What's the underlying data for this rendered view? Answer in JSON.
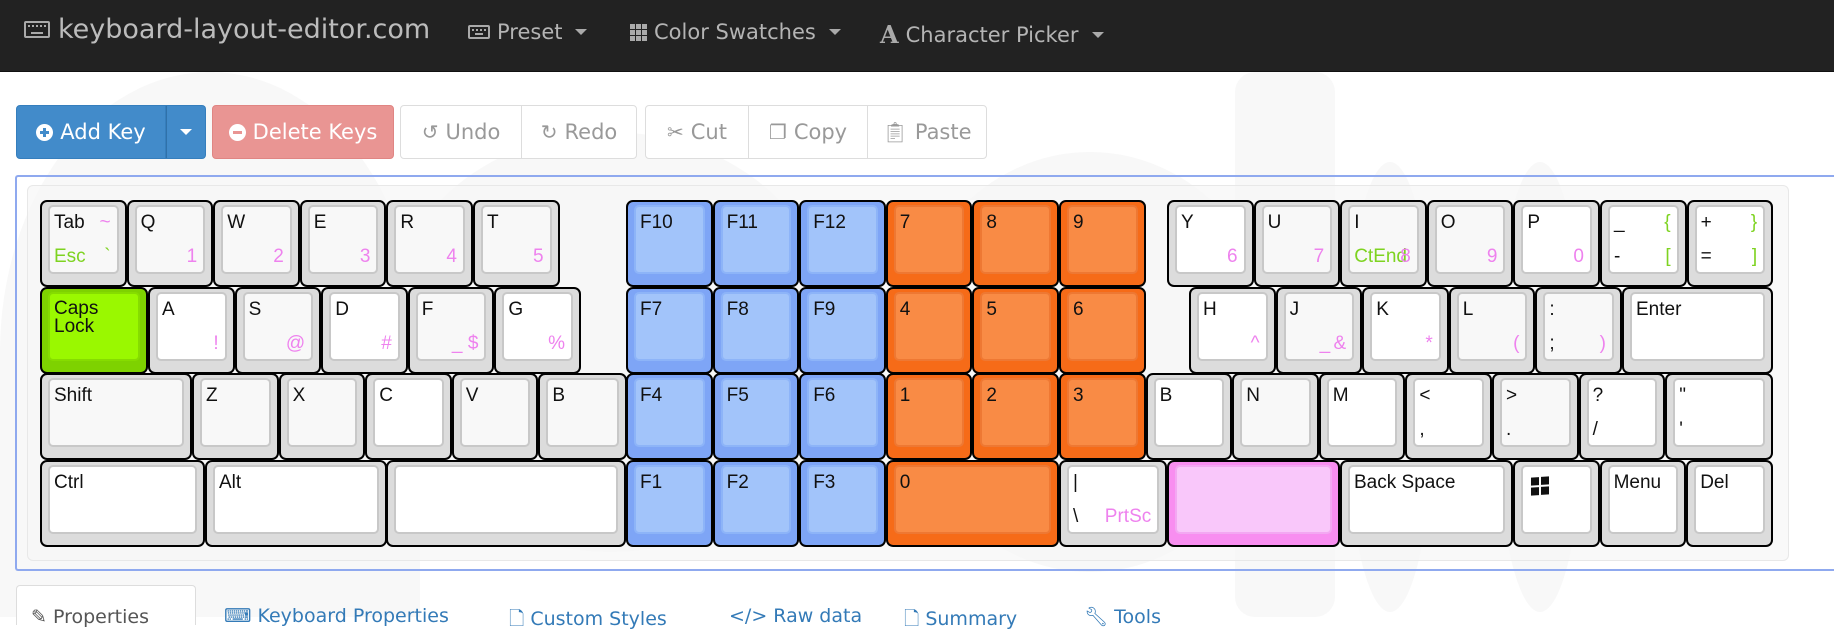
{
  "navbar": {
    "brand": "keyboard-layout-editor.com",
    "brand_icon": "keyboard-icon",
    "menus": [
      {
        "label": "Preset",
        "icon": "keyboard-icon"
      },
      {
        "label": "Color Swatches",
        "icon": "grid-icon"
      },
      {
        "label": "Character Picker",
        "icon": "font-icon"
      }
    ]
  },
  "toolbar": {
    "add_key": "Add Key",
    "delete_keys": "Delete Keys",
    "undo": "Undo",
    "redo": "Redo",
    "cut": "Cut",
    "copy": "Copy",
    "paste": "Paste"
  },
  "colors": {
    "blue_keys": "#a2c4fa",
    "orange_keys": "#f98b45",
    "green_key": "#9af800",
    "pink_key": "#f9c7fa",
    "accent": "#428bca",
    "danger": "#e99593",
    "legend_magenta": "#ee82ee",
    "legend_green": "#7ed321"
  },
  "keyboard": {
    "rows": [
      [
        {
          "id": "tab",
          "style": "",
          "legends": {
            "tl": "Tab",
            "tr": "~",
            "bl": "Esc",
            "br": "`"
          },
          "colors": {
            "tr": "mag",
            "bl": "grn",
            "br": "grn"
          }
        },
        {
          "id": "q",
          "style": "",
          "legends": {
            "tl": "Q",
            "br": "1"
          }
        },
        {
          "id": "w",
          "style": "",
          "legends": {
            "tl": "W",
            "br": "2"
          }
        },
        {
          "id": "e",
          "style": "",
          "legends": {
            "tl": "E",
            "br": "3"
          }
        },
        {
          "id": "r",
          "style": "",
          "legends": {
            "tl": "R",
            "br": "4"
          }
        },
        {
          "id": "t",
          "style": "",
          "legends": {
            "tl": "T",
            "br": "5"
          }
        },
        {
          "id": "f10",
          "style": "blue",
          "legends": {
            "tl": "F10"
          }
        },
        {
          "id": "f11",
          "style": "blue",
          "legends": {
            "tl": "F11"
          }
        },
        {
          "id": "f12",
          "style": "blue",
          "legends": {
            "tl": "F12"
          }
        },
        {
          "id": "num7",
          "style": "orange",
          "legends": {
            "tl": "7"
          }
        },
        {
          "id": "num8",
          "style": "orange",
          "legends": {
            "tl": "8"
          }
        },
        {
          "id": "num9",
          "style": "orange",
          "legends": {
            "tl": "9"
          }
        },
        {
          "id": "y",
          "style": "white",
          "legends": {
            "tl": "Y",
            "br": "6"
          }
        },
        {
          "id": "u",
          "style": "",
          "legends": {
            "tl": "U",
            "br": "7"
          }
        },
        {
          "id": "i",
          "style": "",
          "legends": {
            "tl": "I",
            "bl": "CtEnd",
            "br": "8"
          },
          "colors": {
            "bl": "grn"
          }
        },
        {
          "id": "o",
          "style": "",
          "legends": {
            "tl": "O",
            "br": "9"
          }
        },
        {
          "id": "p",
          "style": "white",
          "legends": {
            "tl": "P",
            "br": "0"
          }
        },
        {
          "id": "minus",
          "style": "white",
          "legends": {
            "tl": "_",
            "tr": "{",
            "bl": "-",
            "br": "["
          },
          "colors": {
            "tr": "grn",
            "br": "grn"
          }
        },
        {
          "id": "equal",
          "style": "white",
          "legends": {
            "tl": "+",
            "tr": "}",
            "bl": "=",
            "br": "]"
          },
          "colors": {
            "tr": "grn",
            "br": "grn"
          }
        }
      ],
      [
        {
          "id": "caps",
          "style": "green",
          "legends": {
            "tl": "Caps\nLock"
          }
        },
        {
          "id": "a",
          "style": "white",
          "legends": {
            "tl": "A",
            "br": "!"
          }
        },
        {
          "id": "s",
          "style": "",
          "legends": {
            "tl": "S",
            "br": "@"
          }
        },
        {
          "id": "d",
          "style": "white",
          "legends": {
            "tl": "D",
            "br": "#"
          }
        },
        {
          "id": "f",
          "style": "",
          "legends": {
            "tl": "F",
            "mr": "_",
            "br": "$"
          }
        },
        {
          "id": "g",
          "style": "white",
          "legends": {
            "tl": "G",
            "br": "%"
          }
        },
        {
          "id": "f7",
          "style": "blue",
          "legends": {
            "tl": "F7"
          }
        },
        {
          "id": "f8",
          "style": "blue",
          "legends": {
            "tl": "F8"
          }
        },
        {
          "id": "f9",
          "style": "blue",
          "legends": {
            "tl": "F9"
          }
        },
        {
          "id": "num4",
          "style": "orange",
          "legends": {
            "tl": "4"
          }
        },
        {
          "id": "num5",
          "style": "orange",
          "legends": {
            "tl": "5"
          }
        },
        {
          "id": "num6",
          "style": "orange",
          "legends": {
            "tl": "6"
          }
        },
        {
          "id": "h",
          "style": "white",
          "legends": {
            "tl": "H",
            "br": "^"
          }
        },
        {
          "id": "j",
          "style": "",
          "legends": {
            "tl": "J",
            "mr": "_",
            "br": "&"
          }
        },
        {
          "id": "k",
          "style": "white",
          "legends": {
            "tl": "K",
            "br": "*"
          }
        },
        {
          "id": "l",
          "style": "",
          "legends": {
            "tl": "L",
            "br": "("
          }
        },
        {
          "id": "semicolon",
          "style": "",
          "legends": {
            "tl": ":",
            "bl": ";",
            "br": ")"
          },
          "colors": {
            "bl": "dark"
          }
        },
        {
          "id": "enter",
          "style": "white",
          "legends": {
            "tl": "Enter"
          }
        }
      ],
      [
        {
          "id": "shift",
          "style": "",
          "legends": {
            "tl": "Shift"
          }
        },
        {
          "id": "z",
          "style": "",
          "legends": {
            "tl": "Z"
          }
        },
        {
          "id": "x",
          "style": "",
          "legends": {
            "tl": "X"
          }
        },
        {
          "id": "c",
          "style": "white",
          "legends": {
            "tl": "C"
          }
        },
        {
          "id": "v",
          "style": "",
          "legends": {
            "tl": "V"
          }
        },
        {
          "id": "b_left",
          "style": "",
          "legends": {
            "tl": "B"
          }
        },
        {
          "id": "f4",
          "style": "blue",
          "legends": {
            "tl": "F4"
          }
        },
        {
          "id": "f5",
          "style": "blue",
          "legends": {
            "tl": "F5"
          }
        },
        {
          "id": "f6",
          "style": "blue",
          "legends": {
            "tl": "F6"
          }
        },
        {
          "id": "num1",
          "style": "orange",
          "legends": {
            "tl": "1"
          }
        },
        {
          "id": "num2",
          "style": "orange",
          "legends": {
            "tl": "2"
          }
        },
        {
          "id": "num3",
          "style": "orange",
          "legends": {
            "tl": "3"
          }
        },
        {
          "id": "b_right",
          "style": "white",
          "legends": {
            "tl": "B"
          }
        },
        {
          "id": "n",
          "style": "",
          "legends": {
            "tl": "N"
          }
        },
        {
          "id": "m",
          "style": "white",
          "legends": {
            "tl": "M"
          }
        },
        {
          "id": "comma",
          "style": "white",
          "legends": {
            "tl": "<",
            "bl": ","
          }
        },
        {
          "id": "period",
          "style": "",
          "legends": {
            "tl": ">",
            "bl": "."
          }
        },
        {
          "id": "slash",
          "style": "white",
          "legends": {
            "tl": "?",
            "bl": "/"
          }
        },
        {
          "id": "quote",
          "style": "white",
          "legends": {
            "tl": "\"",
            "bl": "'"
          }
        }
      ],
      [
        {
          "id": "ctrl",
          "style": "white",
          "legends": {
            "tl": "Ctrl"
          }
        },
        {
          "id": "alt",
          "style": "white",
          "legends": {
            "tl": "Alt"
          }
        },
        {
          "id": "space",
          "style": "white",
          "legends": {}
        },
        {
          "id": "f1",
          "style": "blue",
          "legends": {
            "tl": "F1"
          }
        },
        {
          "id": "f2",
          "style": "blue",
          "legends": {
            "tl": "F2"
          }
        },
        {
          "id": "f3",
          "style": "blue",
          "legends": {
            "tl": "F3"
          }
        },
        {
          "id": "num0",
          "style": "orange",
          "legends": {
            "tl": "0"
          }
        },
        {
          "id": "pipe",
          "style": "white",
          "legends": {
            "tl": "|",
            "bl": "\\",
            "br": "PrtSc"
          }
        },
        {
          "id": "pink_blank",
          "style": "pink",
          "legends": {}
        },
        {
          "id": "backspace",
          "style": "white",
          "legends": {
            "tl": "Back Space"
          }
        },
        {
          "id": "win",
          "style": "white",
          "legends": {
            "icon": "windows-icon"
          }
        },
        {
          "id": "menu",
          "style": "white",
          "legends": {
            "tl": "Menu"
          }
        },
        {
          "id": "del",
          "style": "white",
          "legends": {
            "tl": "Del"
          }
        }
      ]
    ]
  },
  "tabs": [
    {
      "label": "Properties",
      "icon": "edit-icon",
      "active": true
    },
    {
      "label": "Keyboard Properties",
      "icon": "keyboard-icon",
      "active": false
    },
    {
      "label": "Custom Styles",
      "icon": "file-icon",
      "active": false
    },
    {
      "label": "Raw data",
      "icon": "code-icon",
      "active": false
    },
    {
      "label": "Summary",
      "icon": "file-icon",
      "active": false
    },
    {
      "label": "Tools",
      "icon": "wrench-icon",
      "active": false
    }
  ]
}
